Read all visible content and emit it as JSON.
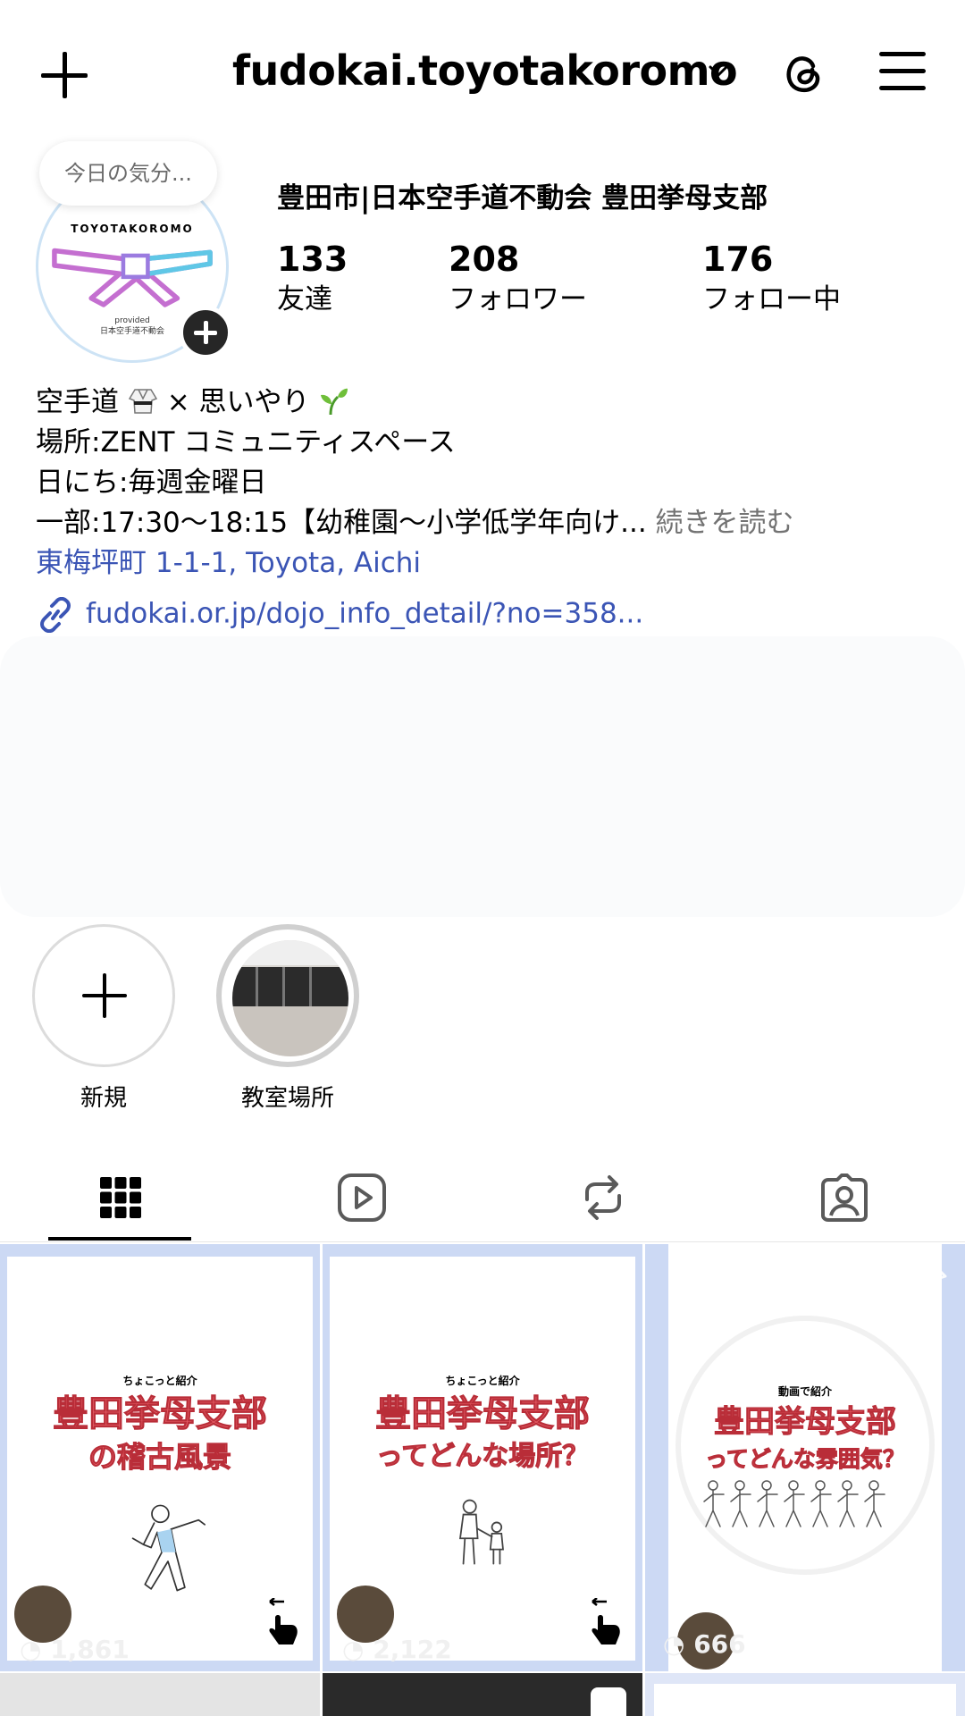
{
  "header": {
    "username": "fudokai.toyotakoromo"
  },
  "profile": {
    "note": "今日の気分...",
    "avatar_text": "TOYOTAKOROMO",
    "avatar_sub1": "provided",
    "avatar_sub2": "日本空手道不動会",
    "display_name": "豊田市|日本空手道不動会 豊田挙母支部",
    "stats": [
      {
        "value": "133",
        "label": "友達"
      },
      {
        "value": "208",
        "label": "フォロワー"
      },
      {
        "value": "176",
        "label": "フォロー中"
      }
    ]
  },
  "bio": {
    "line1_a": "空手道",
    "line1_b": "× 思いやり",
    "line2": "場所:ZENT コミュニティスペース",
    "line3": "日にち:毎週金曜日",
    "line4": "一部:17:30～18:15【幼稚園～小学低学年向け...",
    "more": "続きを読む",
    "location": "東梅坪町 1-1-1, Toyota, Aichi",
    "link": "fudokai.or.jp/dojo_info_detail/?no=358..."
  },
  "highlights": [
    {
      "label": "新規"
    },
    {
      "label": "教室場所"
    }
  ],
  "tabs": [
    "posts",
    "reels",
    "reposts",
    "tagged"
  ],
  "grid": [
    {
      "small": "ちょこっと紹介",
      "title1": "豊田挙母支部",
      "title2": "の稽古風景",
      "views": "1,861"
    },
    {
      "small": "ちょこっと紹介",
      "title1": "豊田挙母支部",
      "title2": "ってどんな場所？",
      "views": "2,122"
    },
    {
      "small": "動画で紹介",
      "title1": "豊田挙母支部",
      "title2": "ってどんな雰囲気？",
      "views": "666"
    }
  ],
  "colors": {
    "link": "#3b55b5",
    "tile_border": "#ccd9f4",
    "tile_title": "#e85f68"
  }
}
